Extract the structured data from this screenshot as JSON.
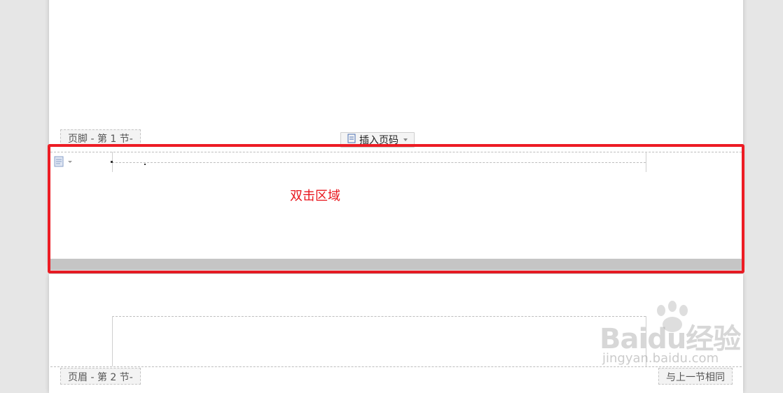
{
  "page1": {
    "footer_tab": "页脚 - 第 1 节-",
    "insert_page_number": "插入页码"
  },
  "annotation": {
    "callout_text": "双击区域",
    "color": "#ed1c24"
  },
  "page2": {
    "header_tab": "页眉 - 第 2 节-",
    "same_as_previous": "与上一节相同"
  },
  "watermark": {
    "logo": "Baidu经验",
    "url": "jingyan.baidu.com"
  },
  "icons": {
    "insert_page_number": "page-number-icon",
    "footer_options": "document-options-icon"
  }
}
